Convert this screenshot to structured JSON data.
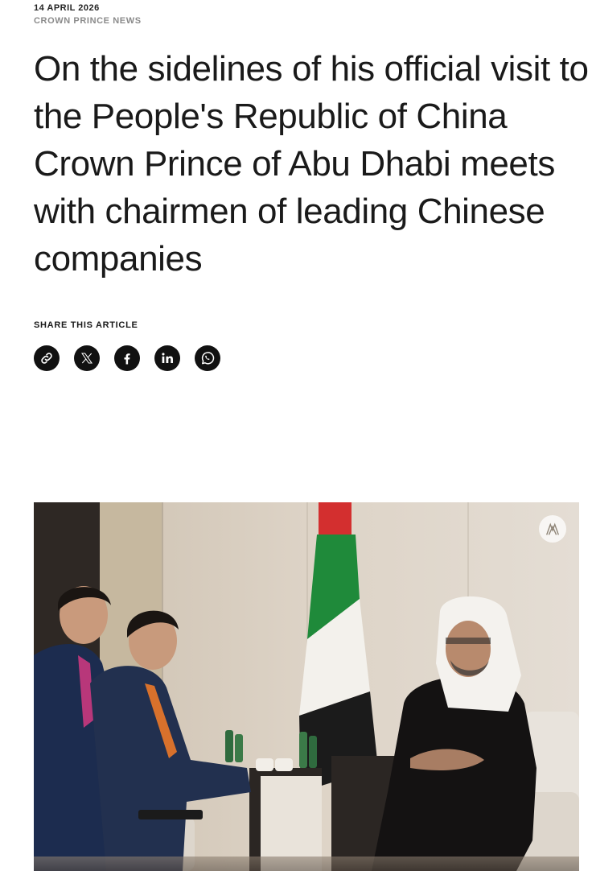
{
  "article": {
    "date": "14 APRIL 2026",
    "category": "CROWN PRINCE NEWS",
    "headline": "On the sidelines of his official visit to the People's Republic of China Crown Prince of Abu Dhabi meets with chairmen of leading Chinese companies"
  },
  "share": {
    "label": "SHARE THIS ARTICLE",
    "buttons": [
      {
        "icon": "link-icon"
      },
      {
        "icon": "x-icon"
      },
      {
        "icon": "facebook-icon"
      },
      {
        "icon": "linkedin-icon"
      },
      {
        "icon": "whatsapp-icon"
      }
    ]
  },
  "photo": {
    "watermark_icon": "emblem-icon"
  },
  "colors": {
    "text": "#1a1a1a",
    "muted": "#8a8a8a",
    "icon_bg": "#111111",
    "flag_red": "#d32f2f",
    "flag_green": "#1f8a3a",
    "flag_black": "#1b1b1b"
  }
}
